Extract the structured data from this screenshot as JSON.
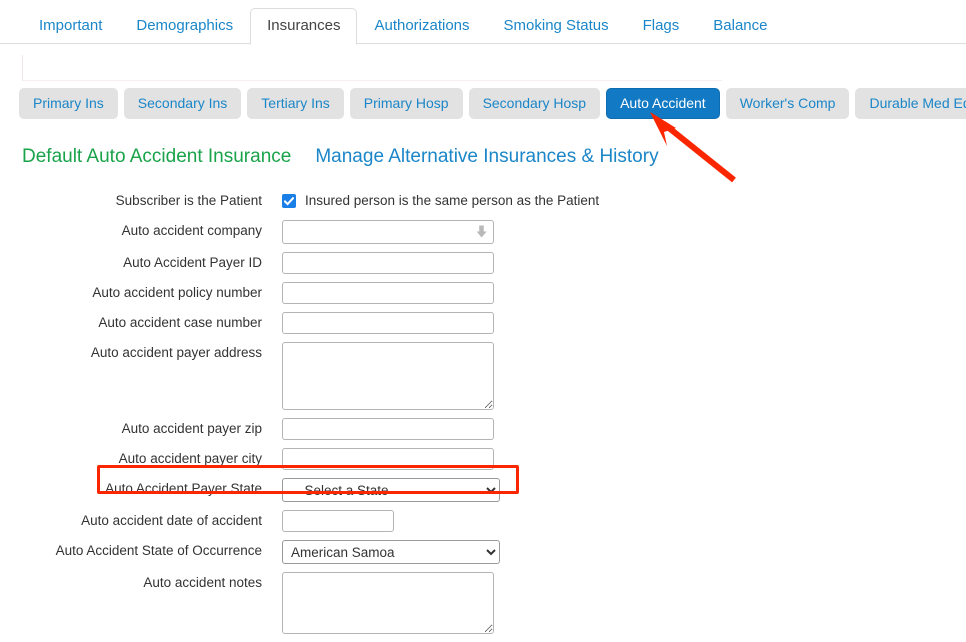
{
  "tabs": {
    "items": [
      {
        "label": "Important",
        "active": false
      },
      {
        "label": "Demographics",
        "active": false
      },
      {
        "label": "Insurances",
        "active": true
      },
      {
        "label": "Authorizations",
        "active": false
      },
      {
        "label": "Smoking Status",
        "active": false
      },
      {
        "label": "Flags",
        "active": false
      },
      {
        "label": "Balance",
        "active": false
      }
    ]
  },
  "subtabs": {
    "items": [
      {
        "label": "Primary Ins",
        "active": false
      },
      {
        "label": "Secondary Ins",
        "active": false
      },
      {
        "label": "Tertiary Ins",
        "active": false
      },
      {
        "label": "Primary Hosp",
        "active": false
      },
      {
        "label": "Secondary Hosp",
        "active": false
      },
      {
        "label": "Auto Accident",
        "active": true
      },
      {
        "label": "Worker's Comp",
        "active": false
      },
      {
        "label": "Durable Med Eqpt",
        "active": false
      }
    ]
  },
  "headings": {
    "default_title": "Default Auto Accident Insurance",
    "manage_link": "Manage Alternative Insurances & History"
  },
  "form": {
    "subscriber": {
      "label": "Subscriber is the Patient",
      "checkbox_checked": true,
      "checkbox_text": "Insured person is the same person as the Patient"
    },
    "company": {
      "label": "Auto accident company",
      "value": "",
      "placeholder": ""
    },
    "payer_id": {
      "label": "Auto Accident Payer ID",
      "value": "",
      "placeholder": ""
    },
    "policy_number": {
      "label": "Auto accident policy number",
      "value": "",
      "placeholder": ""
    },
    "case_number": {
      "label": "Auto accident case number",
      "value": "",
      "placeholder": ""
    },
    "payer_address": {
      "label": "Auto accident payer address",
      "value": "",
      "placeholder": ""
    },
    "payer_zip": {
      "label": "Auto accident payer zip",
      "value": "",
      "placeholder": ""
    },
    "payer_city": {
      "label": "Auto accident payer city",
      "value": "",
      "placeholder": ""
    },
    "payer_state": {
      "label": "Auto Accident Payer State",
      "selected": "—Select a State—",
      "options": [
        "—Select a State—"
      ]
    },
    "date_of_accident": {
      "label": "Auto accident date of accident",
      "value": "",
      "placeholder": ""
    },
    "state_of_occurrence": {
      "label": "Auto Accident State of Occurrence",
      "selected": "American Samoa",
      "options": [
        "American Samoa"
      ]
    },
    "notes": {
      "label": "Auto accident notes",
      "value": "",
      "placeholder": ""
    }
  },
  "annotations": {
    "highlight_color": "#fa2600",
    "arrow_color": "#fa2600",
    "highlight_target": "Auto Accident Payer State",
    "arrow_target": "Auto Accident"
  },
  "colors": {
    "tab_link": "#1b86c8",
    "active_subtab_bg": "#1279c4",
    "subtab_bg": "#e2e2e2",
    "heading_green": "#19a34a",
    "heading_blue": "#1b86c8",
    "checkbox_blue": "#1b7fe8"
  }
}
